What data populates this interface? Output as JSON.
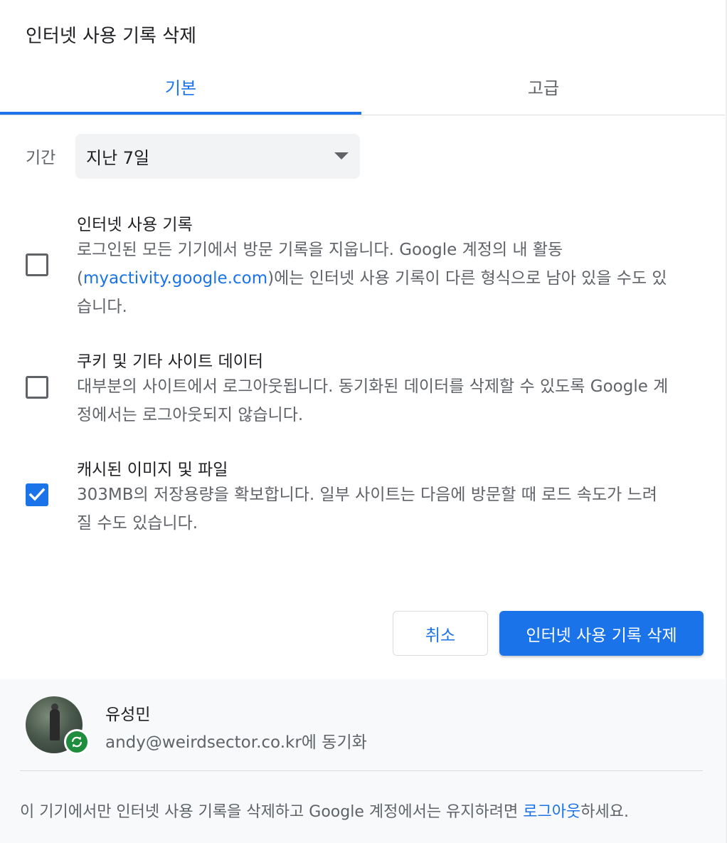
{
  "dialog": {
    "title": "인터넷 사용 기록 삭제"
  },
  "tabs": [
    {
      "label": "기본",
      "selected": true
    },
    {
      "label": "고급",
      "selected": false
    }
  ],
  "period": {
    "label": "기간",
    "value": "지난 7일"
  },
  "options": [
    {
      "title": "인터넷 사용 기록",
      "desc_line1": "로그인된 모든 기기에서 방문 기록을 지웁니다. Google 계정의 내 활동",
      "desc_line2_pre": "(",
      "desc_line2_link": "myactivity.google.com",
      "desc_line2_post": ")에는 인터넷 사용 기록이 다른 형식으로 남아 있을 수도 있",
      "desc_line3": "습니다.",
      "checked": false
    },
    {
      "title": "쿠키 및 기타 사이트 데이터",
      "desc_line1": "대부분의 사이트에서 로그아웃됩니다. 동기화된 데이터를 삭제할 수 있도록 Google 계",
      "desc_line2": "정에서는 로그아웃되지 않습니다.",
      "checked": false
    },
    {
      "title": "캐시된 이미지 및 파일",
      "desc_line1": "303MB의 저장용량을 확보합니다. 일부 사이트는 다음에 방문할 때 로드 속도가 느려",
      "desc_line2": "질 수도 있습니다.",
      "checked": true
    }
  ],
  "buttons": {
    "cancel": "취소",
    "delete": "인터넷 사용 기록 삭제"
  },
  "account": {
    "name": "유성민",
    "sync_text": "andy@weirdsector.co.kr에 동기화"
  },
  "footer": {
    "note_pre": "이 기기에서만 인터넷 사용 기록을 삭제하고 Google 계정에서는 유지하려면 ",
    "note_link": "로그아웃",
    "note_post": "하세요."
  },
  "colors": {
    "accent": "#1a73e8",
    "sync_badge": "#1e8e3e"
  }
}
